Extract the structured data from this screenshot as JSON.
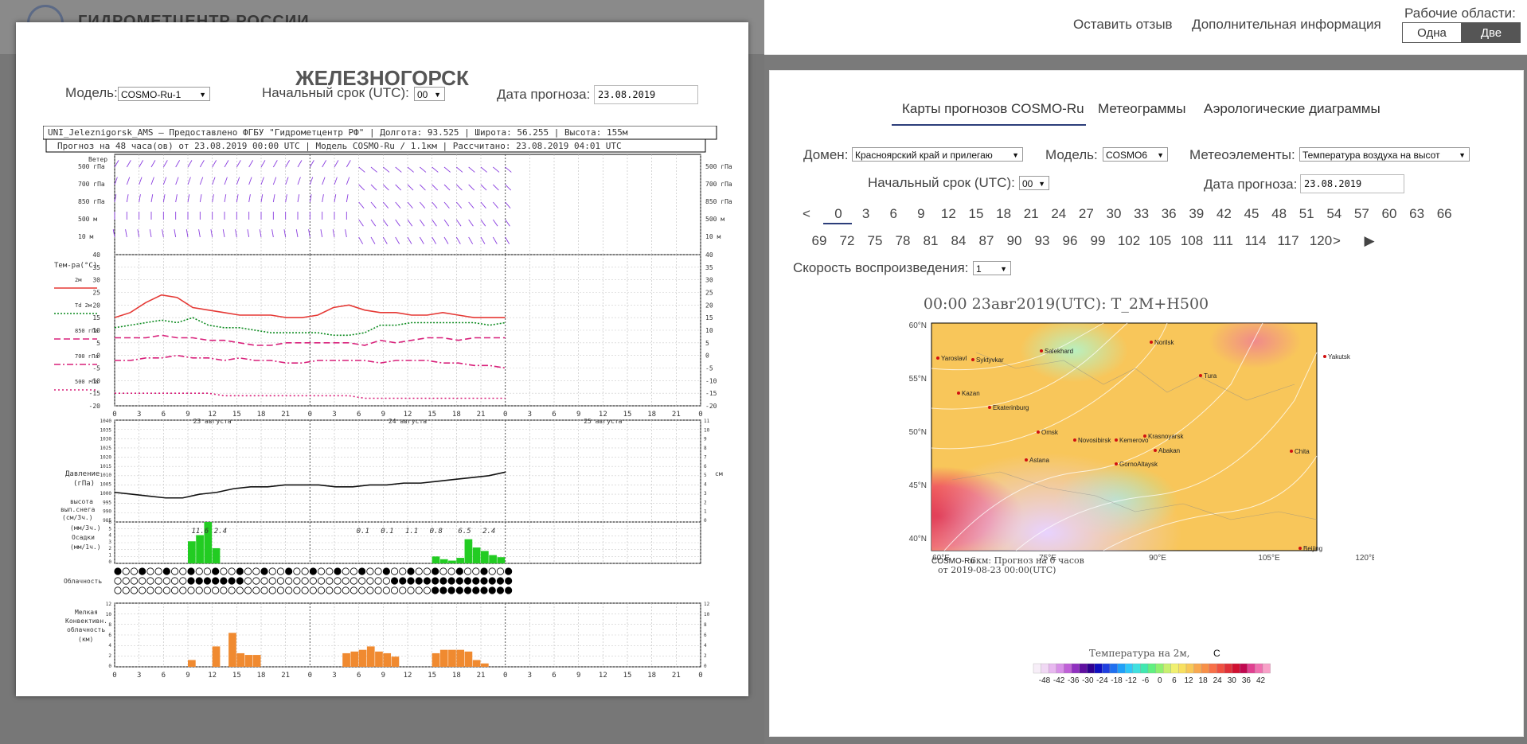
{
  "left_page": {
    "brand": "ГИДРОМЕТЦЕНТР РОССИИ"
  },
  "modal": {
    "title": "ЖЕЛЕЗНОГОРСК",
    "model_label": "Модель:",
    "model_value": "COSMO-Ru-1",
    "init_label": "Начальный срок (UTC):",
    "init_value": "00",
    "date_label": "Дата прогноза:",
    "date_value": "23.08.2019",
    "meteogram": {
      "header1": "UNI_Jeleznigorsk_AMS – Предоставлено ФГБУ \"Гидрометцентр РФ\" | Долгота: 93.525 | Широта: 56.255 | Высота: 155м",
      "header2": "Прогноз на 48 часа(ов) от 23.08.2019 00:00 UTC | Модель COSMO-Ru / 1.1км | Рассчитано: 23.08.2019 04:01 UTC",
      "wind": {
        "label": "Ветер",
        "levels": [
          "500 гПа",
          "700 гПа",
          "850 гПа",
          "500 м",
          "10 м"
        ]
      },
      "temp": {
        "label": "Тем-ра(°C)",
        "series_labels": [
          "2м",
          "Td 2м",
          "850 гПа",
          "700 гПа",
          "500 гПа"
        ],
        "ticks": [
          "40",
          "35",
          "30",
          "25",
          "20",
          "15",
          "10",
          "5",
          "0",
          "-5",
          "-10",
          "-15",
          "-20"
        ],
        "colors": {
          "t2m": "#e53935",
          "td2m": "#0b8a1e",
          "t850": "#d8207a",
          "t700": "#d8207a",
          "t500": "#d8207a"
        }
      },
      "pressure": {
        "label1": "Давление",
        "label2": "(гПа)",
        "snow1": "высота",
        "snow2": "вып.снега",
        "snow3": "(см/3ч.)",
        "ticks_left": [
          "1040",
          "1035",
          "1030",
          "1025",
          "1020",
          "1015",
          "1010",
          "1005",
          "1000",
          "995",
          "990",
          "985"
        ],
        "ticks_right": [
          "11",
          "10",
          "9",
          "8",
          "7",
          "6",
          "5",
          "4",
          "3",
          "2",
          "1",
          "0"
        ],
        "unit_right": "см"
      },
      "precip": {
        "label1": "(мм/3ч.)",
        "label2": "Осадки",
        "label3": "(мм/1ч.)",
        "totals": [
          "11.6",
          "2.4",
          "0.1",
          "0.1",
          "1.1",
          "0.8",
          "6.5",
          "2.4"
        ],
        "ticks": [
          "6",
          "5",
          "4",
          "3",
          "2",
          "1",
          "0"
        ],
        "bar_color": "#22cc22"
      },
      "cloud": {
        "label": "Облачность"
      },
      "convective": {
        "label1": "Мелкая",
        "label2": "Конвективн.",
        "label3": "облачность",
        "label4": "(км)",
        "ticks": [
          "12",
          "10",
          "8",
          "6",
          "4",
          "2",
          "0"
        ],
        "bar_color": "#f08a30"
      },
      "x_hours": [
        "0",
        "3",
        "6",
        "9",
        "12",
        "15",
        "18",
        "21"
      ],
      "day_labels": [
        "23 августа",
        "24 августа",
        "25 августа"
      ]
    }
  },
  "header": {
    "feedback": "Оставить отзыв",
    "more_info": "Дополнительная информация",
    "workspaces_label": "Рабочие области:",
    "ws_one": "Одна",
    "ws_two": "Две"
  },
  "tabs": [
    "Карты прогнозов COSMO-Ru",
    "Метеограммы",
    "Аэрологические диаграммы"
  ],
  "controls": {
    "domain_label": "Домен:",
    "domain_value": "Красноярский край и прилегаю",
    "model_label": "Модель:",
    "model_value": "COSMO6",
    "elements_label": "Метеоэлементы:",
    "elements_value": "Температура воздуха на высот",
    "init_label": "Начальный срок (UTC):",
    "init_value": "00",
    "date_label": "Дата прогноза:",
    "date_value": "23.08.2019",
    "speed_label": "Скорость воспроизведения:",
    "speed_value": "1"
  },
  "hours": {
    "prev": "<",
    "next": ">",
    "play": "▶",
    "selected": "0",
    "row1": [
      "0",
      "3",
      "6",
      "9",
      "12",
      "15",
      "18",
      "21",
      "24",
      "27",
      "30",
      "33",
      "36",
      "39",
      "42",
      "45",
      "48",
      "51",
      "54",
      "57",
      "60",
      "63",
      "66"
    ],
    "row2": [
      "69",
      "72",
      "75",
      "78",
      "81",
      "84",
      "87",
      "90",
      "93",
      "96",
      "99",
      "102",
      "105",
      "108",
      "111",
      "114",
      "117",
      "120"
    ]
  },
  "map": {
    "title": "00:00 23авг2019(UTC): T_2M+H500",
    "lat_labels": [
      "60°N",
      "55°N",
      "50°N",
      "45°N",
      "40°N"
    ],
    "lon_labels": [
      "60°E",
      "75°E",
      "90°E",
      "105°E",
      "120°E"
    ],
    "cities": [
      "Yaroslavl",
      "Syktyvkar",
      "Salekhard",
      "Norilsk",
      "Yakutsk",
      "Kazan",
      "Tura",
      "Ekaterinburg",
      "Omsk",
      "Novosibirsk",
      "Kemerovo",
      "Krasnoyarsk",
      "Abakan",
      "Astana",
      "GornoAltaysk",
      "Chita",
      "Beijing"
    ],
    "model_name": "COSMO-Ru",
    "caption1": "6км: Прогноз на 0 часов",
    "caption2": "от 2019-08-23 00:00(UTC)",
    "legend_title": "Температура на 2м,",
    "legend_unit": "C",
    "legend_ticks": [
      "-48",
      "-42",
      "-36",
      "-30",
      "-24",
      "-18",
      "-12",
      "-6",
      "0",
      "6",
      "12",
      "18",
      "24",
      "30",
      "36",
      "42"
    ]
  }
}
